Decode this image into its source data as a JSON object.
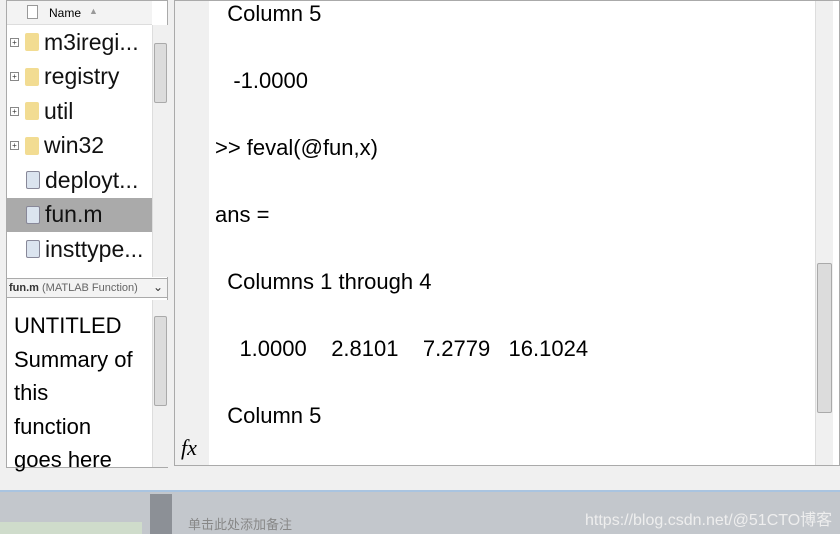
{
  "browser": {
    "column_header": "Name",
    "sort_icon": "triangle-up",
    "items": [
      {
        "label": "m3iregi...",
        "type": "folder"
      },
      {
        "label": "registry",
        "type": "folder"
      },
      {
        "label": "util",
        "type": "folder"
      },
      {
        "label": "win32",
        "type": "folder"
      },
      {
        "label": "deployt...",
        "type": "file"
      },
      {
        "label": "fun.m",
        "type": "mfile",
        "selected": true
      },
      {
        "label": "insttype...",
        "type": "file"
      }
    ]
  },
  "details": {
    "file": "fun.m",
    "kind": "(MATLAB Function)",
    "lines": [
      "UNTITLED",
      "Summary of",
      "this",
      "function",
      "goes here"
    ]
  },
  "command": {
    "lines": [
      "  Column 5",
      "",
      "   -1.0000",
      "",
      ">> feval(@fun,x)",
      "",
      "ans =",
      "",
      "  Columns 1 through 4",
      "",
      "    1.0000    2.8101    7.2779   16.1024",
      "",
      "  Column 5"
    ],
    "fx_label": "fx"
  },
  "footer": {
    "note": "单击此处添加备注",
    "watermark": "https://blog.csdn.net/@51CTO博客"
  }
}
